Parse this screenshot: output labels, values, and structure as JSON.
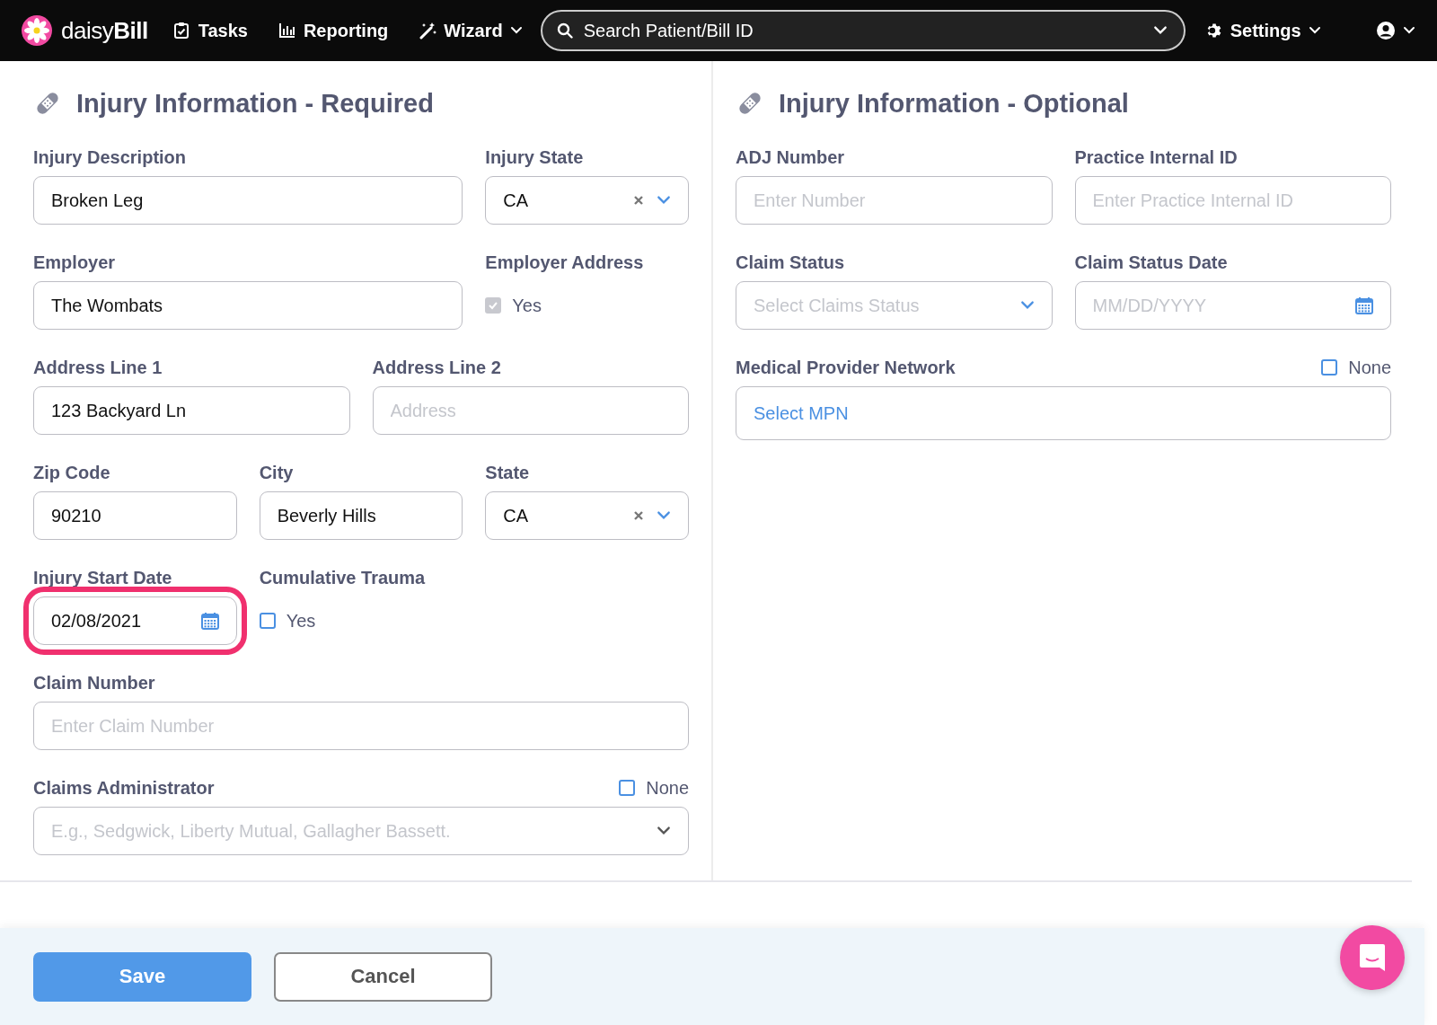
{
  "navbar": {
    "logo": "daisy**Bill**",
    "items": [
      {
        "kind": "tasks",
        "label": "Tasks"
      },
      {
        "kind": "reporting",
        "label": "Reporting"
      },
      {
        "kind": "wizard",
        "label": "Wizard"
      }
    ],
    "search": {
      "placeholder": "Search Patient/Bill ID"
    },
    "settings": {
      "label": "Settings"
    }
  },
  "sections": [
    {
      "title": "Injury Information - Required",
      "rows": [
        [
          {
            "label": "Injury Description",
            "kind": "text",
            "value": "Broken Leg"
          },
          {
            "label": "Injury State",
            "kind": "select",
            "value": "CA"
          }
        ],
        [
          {
            "label": "Employer",
            "kind": "text",
            "value": "The Wombats"
          },
          {
            "label": "Employer Address",
            "kind": "checkbox",
            "option": "Yes",
            "checked": true,
            "disabled": true
          }
        ],
        [
          {
            "label": "Address Line 1",
            "kind": "text",
            "value": "123 Backyard Ln"
          },
          {
            "label": "Address Line 2",
            "kind": "text",
            "placeholder": "Address"
          }
        ],
        [
          {
            "label": "Zip Code",
            "kind": "text",
            "value": "90210"
          },
          {
            "label": "City",
            "kind": "text",
            "value": "Beverly Hills"
          },
          {
            "label": "State",
            "kind": "select",
            "value": "CA"
          }
        ],
        [
          {
            "label": "Injury Start Date",
            "kind": "date",
            "value": "02/08/2021",
            "highlighted": true
          },
          {
            "label": "Cumulative Trauma",
            "kind": "checkbox",
            "option": "Yes",
            "checked": false,
            "disabled": false
          }
        ],
        [
          {
            "label": "Claim Number",
            "kind": "text",
            "placeholder": "Enter Claim Number"
          }
        ],
        [
          {
            "label": "Claims Administrator",
            "kind": "combo",
            "placeholder": "E.g., Sedgwick, Liberty Mutual, Gallagher Bassett.",
            "header_option": {
              "label": "None",
              "checked": false
            }
          }
        ]
      ]
    },
    {
      "title": "Injury Information - Optional",
      "rows": [
        [
          {
            "label": "ADJ Number",
            "kind": "text",
            "placeholder": "Enter Number"
          },
          {
            "label": "Practice Internal ID",
            "kind": "text",
            "placeholder": "Enter Practice Internal ID"
          }
        ],
        [
          {
            "label": "Claim Status",
            "kind": "combo",
            "placeholder": "Select Claims Status"
          },
          {
            "label": "Claim Status Date",
            "kind": "date",
            "placeholder": "MM/DD/YYYY",
            "highlighted": false
          }
        ],
        [
          {
            "label": "Medical Provider Network",
            "kind": "link",
            "value": "Select MPN",
            "header_option": {
              "label": "None",
              "checked": false
            }
          }
        ]
      ]
    }
  ],
  "buttons": [
    {
      "kind": "primary",
      "label": "Save"
    },
    {
      "kind": "secondary",
      "label": "Cancel"
    }
  ]
}
